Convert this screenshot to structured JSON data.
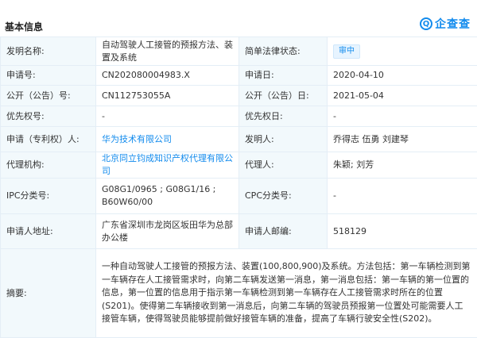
{
  "section": {
    "title": "基本信息",
    "brand": {
      "name": "企查查",
      "icon": "qichacha-logo-icon",
      "icon_glyph": "Q",
      "color": "#128bed"
    }
  },
  "rows": [
    {
      "label": "发明名称:",
      "value": "自动驾驶人工接管的预报方法、装置及系统",
      "label2": "简单法律状态:",
      "value2": "审中"
    },
    {
      "label": "申请号:",
      "value": "CN202080004983.X",
      "label2": "申请日:",
      "value2": "2020-04-10"
    },
    {
      "label": "公开（公告）号:",
      "value": "CN112753055A",
      "label2": "公开（公告）日:",
      "value2": "2021-05-04"
    },
    {
      "label": "优先权号:",
      "value": "-",
      "label2": "优先权日:",
      "value2": "-"
    },
    {
      "label": "申请（专利权）人:",
      "value": "华为技术有限公司",
      "label2": "发明人:",
      "value2": "乔得志 伍勇 刘建琴"
    },
    {
      "label": "代理机构:",
      "value": "北京同立钧成知识产权代理有限公司",
      "label2": "代理人:",
      "value2": "朱颖; 刘芳"
    },
    {
      "label": "IPC分类号:",
      "value": "G08G1/0965 ;  G08G1/16 ;  B60W60/00",
      "label2": "CPC分类号:",
      "value2": "-"
    },
    {
      "label": "申请人地址:",
      "value": "广东省深圳市龙岗区坂田华为总部办公楼",
      "label2": "申请人邮编:",
      "value2": "518129"
    }
  ],
  "abstract": {
    "label": "摘要:",
    "text": "一种自动驾驶人工接管的预报方法、装置(100,800,900)及系统。方法包括：第一车辆检测到第一车辆存在人工接管需求时，向第二车辆发送第一消息，第一消息包括：第一车辆的第一位置的信息，第一位置的信息用于指示第一车辆检测到第一车辆存在人工接管需求时所在的位置(S201)。使得第二车辆接收到第一消息后，向第二车辆的驾驶员预报第一位置处可能需要人工接管车辆，使得驾驶员能够提前做好接管车辆的准备，提高了车辆行驶安全性(S202)。"
  }
}
